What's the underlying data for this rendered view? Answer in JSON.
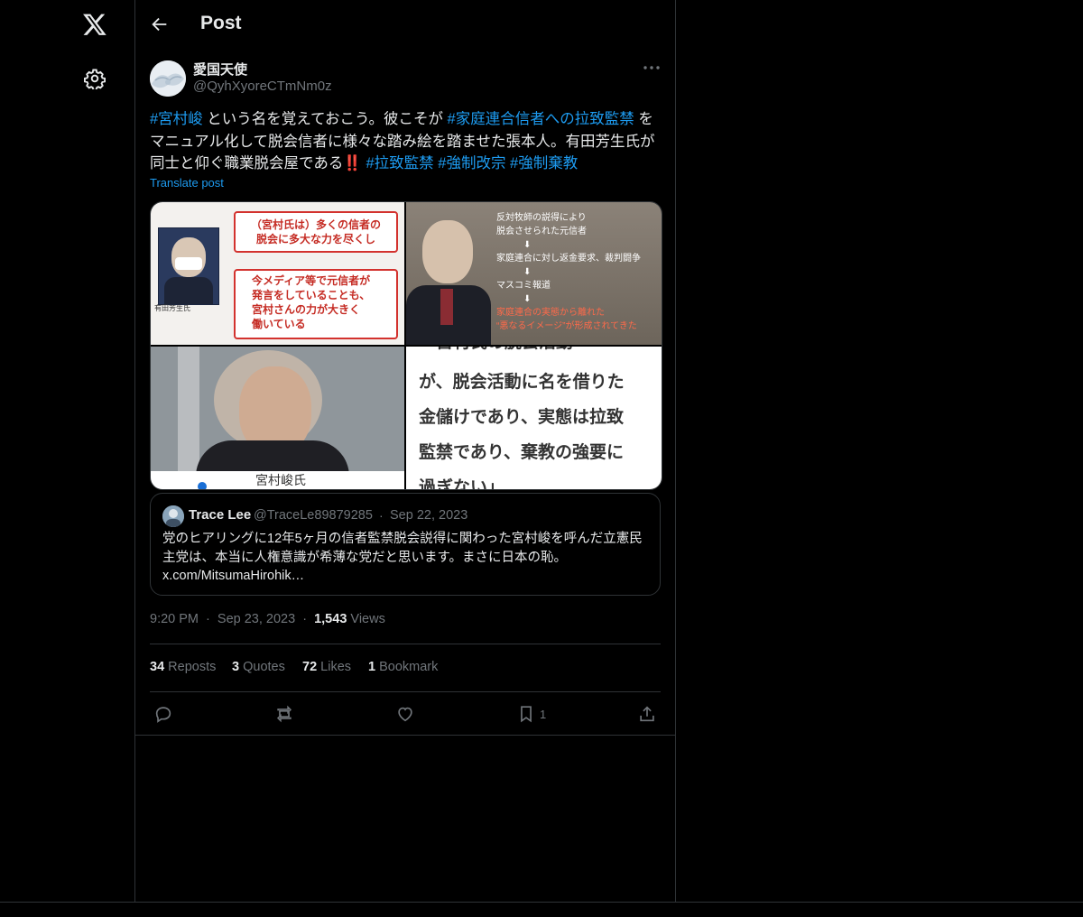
{
  "header": {
    "title": "Post",
    "back_icon": "arrow-left-icon"
  },
  "nav": {
    "logo_icon": "x-logo-icon",
    "settings_icon": "gear-icon"
  },
  "author": {
    "name": "愛国天使",
    "handle": "@QyhXyoreCTmNm0z",
    "more_icon": "more-horizontal-icon"
  },
  "post": {
    "segments": [
      {
        "text": "#宮村峻",
        "hashtag": true
      },
      {
        "text": " という名を覚えておこう。彼こそが ",
        "hashtag": false
      },
      {
        "text": "#家庭連合信者への拉致監禁",
        "hashtag": true
      },
      {
        "text": " をマニュアル化して脱会信者に様々な踏み絵を踏ませた張本人。有田芳生氏が同士と仰ぐ職業脱会屋である",
        "hashtag": false
      },
      {
        "text": "‼️",
        "hashtag": false,
        "emoji": true
      },
      {
        "text": " ",
        "hashtag": false
      },
      {
        "text": "#拉致監禁",
        "hashtag": true
      },
      {
        "text": " ",
        "hashtag": false
      },
      {
        "text": "#強制改宗",
        "hashtag": true
      },
      {
        "text": " ",
        "hashtag": false
      },
      {
        "text": "#強制棄教",
        "hashtag": true
      }
    ],
    "translate_label": "Translate post"
  },
  "media": {
    "tile1": {
      "caption1": "（宮村氏は）多くの信者の脱会に多大な力を尽くし",
      "caption1_l1": "（宮村氏は）多くの信者の",
      "caption1_l2": "脱会に多大な力を尽くし",
      "caption2_l1": "今メディア等で元信者が",
      "caption2_l2": "発言をしていることも、",
      "caption2_l3": "宮村さんの力が大きく",
      "caption2_l4": "働いている",
      "person_label": "有田芳生氏"
    },
    "tile2": {
      "line1": "反対牧師の説得により",
      "line2": "脱会させられた元信者",
      "line3": "家庭連合に対し返金要求、裁判闘争",
      "line4": "マスコミ報道",
      "line5": "家庭連合の実態から離れた",
      "line6": "“悪なるイメージ”が形成されてきた"
    },
    "tile3": {
      "caption": "宮村峻氏"
    },
    "tile4": {
      "line0": "「宮村氏の脱会活動",
      "line1": "が、脱会活動に名を借りた",
      "line2": "金儲けであり、実態は拉致",
      "line3": "監禁であり、棄教の強要に",
      "line4": "過ぎない」"
    }
  },
  "quote": {
    "name": "Trace Lee",
    "handle": "@TraceLe89879285",
    "separator": "·",
    "date": "Sep 22, 2023",
    "text": "党のヒアリングに12年5ヶ月の信者監禁脱会説得に関わった宮村峻を呼んだ立憲民主党は、本当に人権意識が希薄な党だと思います。まさに日本の恥。 x.com/MitsumaHirohik…"
  },
  "meta": {
    "time": "9:20 PM",
    "sep1": "·",
    "date": "Sep 23, 2023",
    "sep2": "·",
    "views_count": "1,543",
    "views_label": "Views"
  },
  "stats": {
    "reposts_count": "34",
    "reposts_label": "Reposts",
    "quotes_count": "3",
    "quotes_label": "Quotes",
    "likes_count": "72",
    "likes_label": "Likes",
    "bookmarks_count": "1",
    "bookmarks_label": "Bookmark"
  },
  "actions": {
    "reply_icon": "reply-icon",
    "repost_icon": "repost-icon",
    "like_icon": "heart-icon",
    "bookmark_icon": "bookmark-icon",
    "bookmark_count": "1",
    "share_icon": "share-icon"
  },
  "colors": {
    "accent": "#1d9bf0",
    "background": "#000000",
    "text": "#e7e9ea",
    "muted": "#71767b",
    "border": "#2f3336"
  }
}
